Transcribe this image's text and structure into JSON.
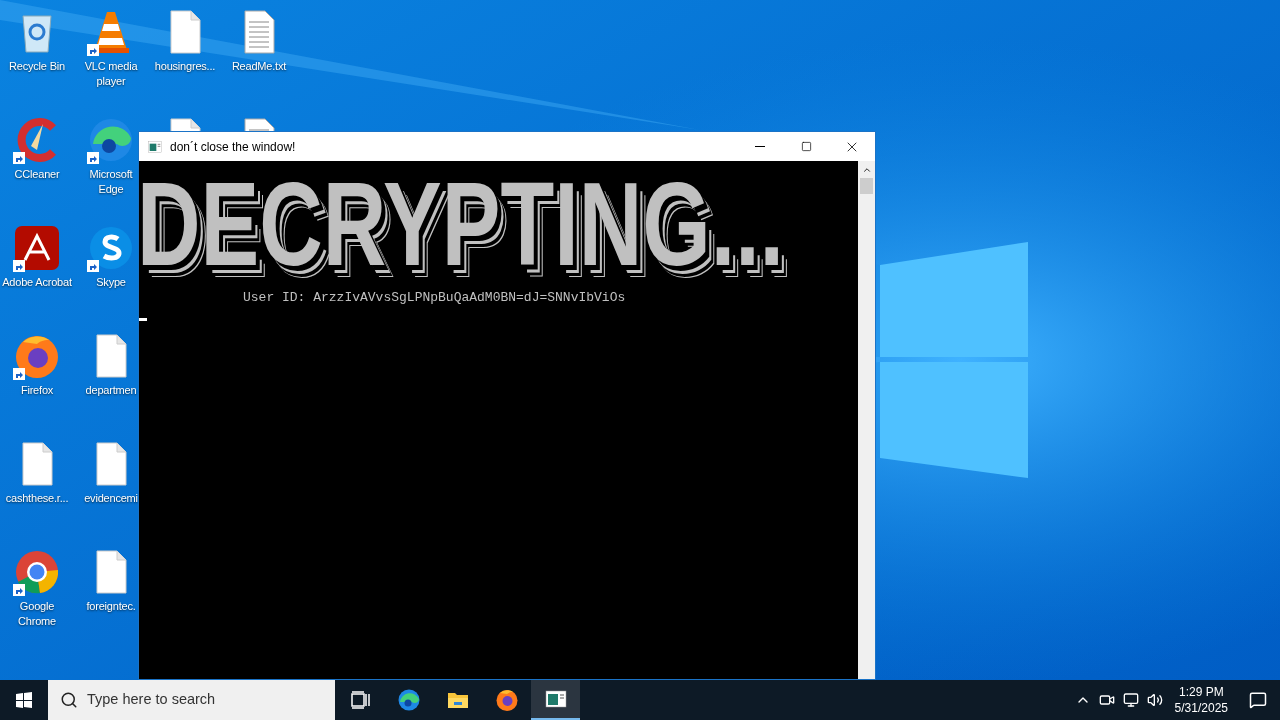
{
  "desktop": {
    "icon_columns": [
      [
        {
          "label": "Recycle Bin",
          "kind": "recycle",
          "shortcut": false
        },
        {
          "label": "CCleaner",
          "kind": "ccleaner",
          "shortcut": true
        },
        {
          "label": "Adobe Acrobat",
          "kind": "acrobat",
          "shortcut": true
        },
        {
          "label": "Firefox",
          "kind": "firefox",
          "shortcut": true
        },
        {
          "label": "cashthese.r...",
          "kind": "file",
          "shortcut": false
        },
        {
          "label": "Google Chrome",
          "kind": "chrome",
          "shortcut": true
        }
      ],
      [
        {
          "label": "VLC media player",
          "kind": "vlc",
          "shortcut": true
        },
        {
          "label": "Microsoft Edge",
          "kind": "edge",
          "shortcut": true
        },
        {
          "label": "Skype",
          "kind": "skype",
          "shortcut": true
        },
        {
          "label": "departmen",
          "kind": "file",
          "shortcut": false
        },
        {
          "label": "evidencemi",
          "kind": "file",
          "shortcut": false
        },
        {
          "label": "foreigntec.",
          "kind": "file",
          "shortcut": false
        }
      ],
      [
        {
          "label": "housingres...",
          "kind": "file",
          "shortcut": false
        },
        {
          "kind": "file",
          "shortcut": false
        }
      ],
      [
        {
          "label": "ReadMe.txt",
          "kind": "text",
          "shortcut": false
        },
        {
          "kind": "text",
          "shortcut": false
        }
      ]
    ]
  },
  "console_window": {
    "title": "don´t close the window!",
    "banner": "DECRYPTING...",
    "lines": [
      "User ID: ArzzIvAVvsSgLPNpBuQaAdM0BN=dJ=SNNvIbViOs"
    ]
  },
  "taskbar": {
    "search": {
      "placeholder": "Type here to search"
    },
    "apps": [
      {
        "kind": "taskview",
        "active": false
      },
      {
        "kind": "edge",
        "active": false
      },
      {
        "kind": "folder",
        "active": false
      },
      {
        "kind": "firefox",
        "active": false
      },
      {
        "kind": "console",
        "active": true
      }
    ],
    "clock": {
      "time": "1:29 PM",
      "date": "5/31/2025"
    }
  }
}
